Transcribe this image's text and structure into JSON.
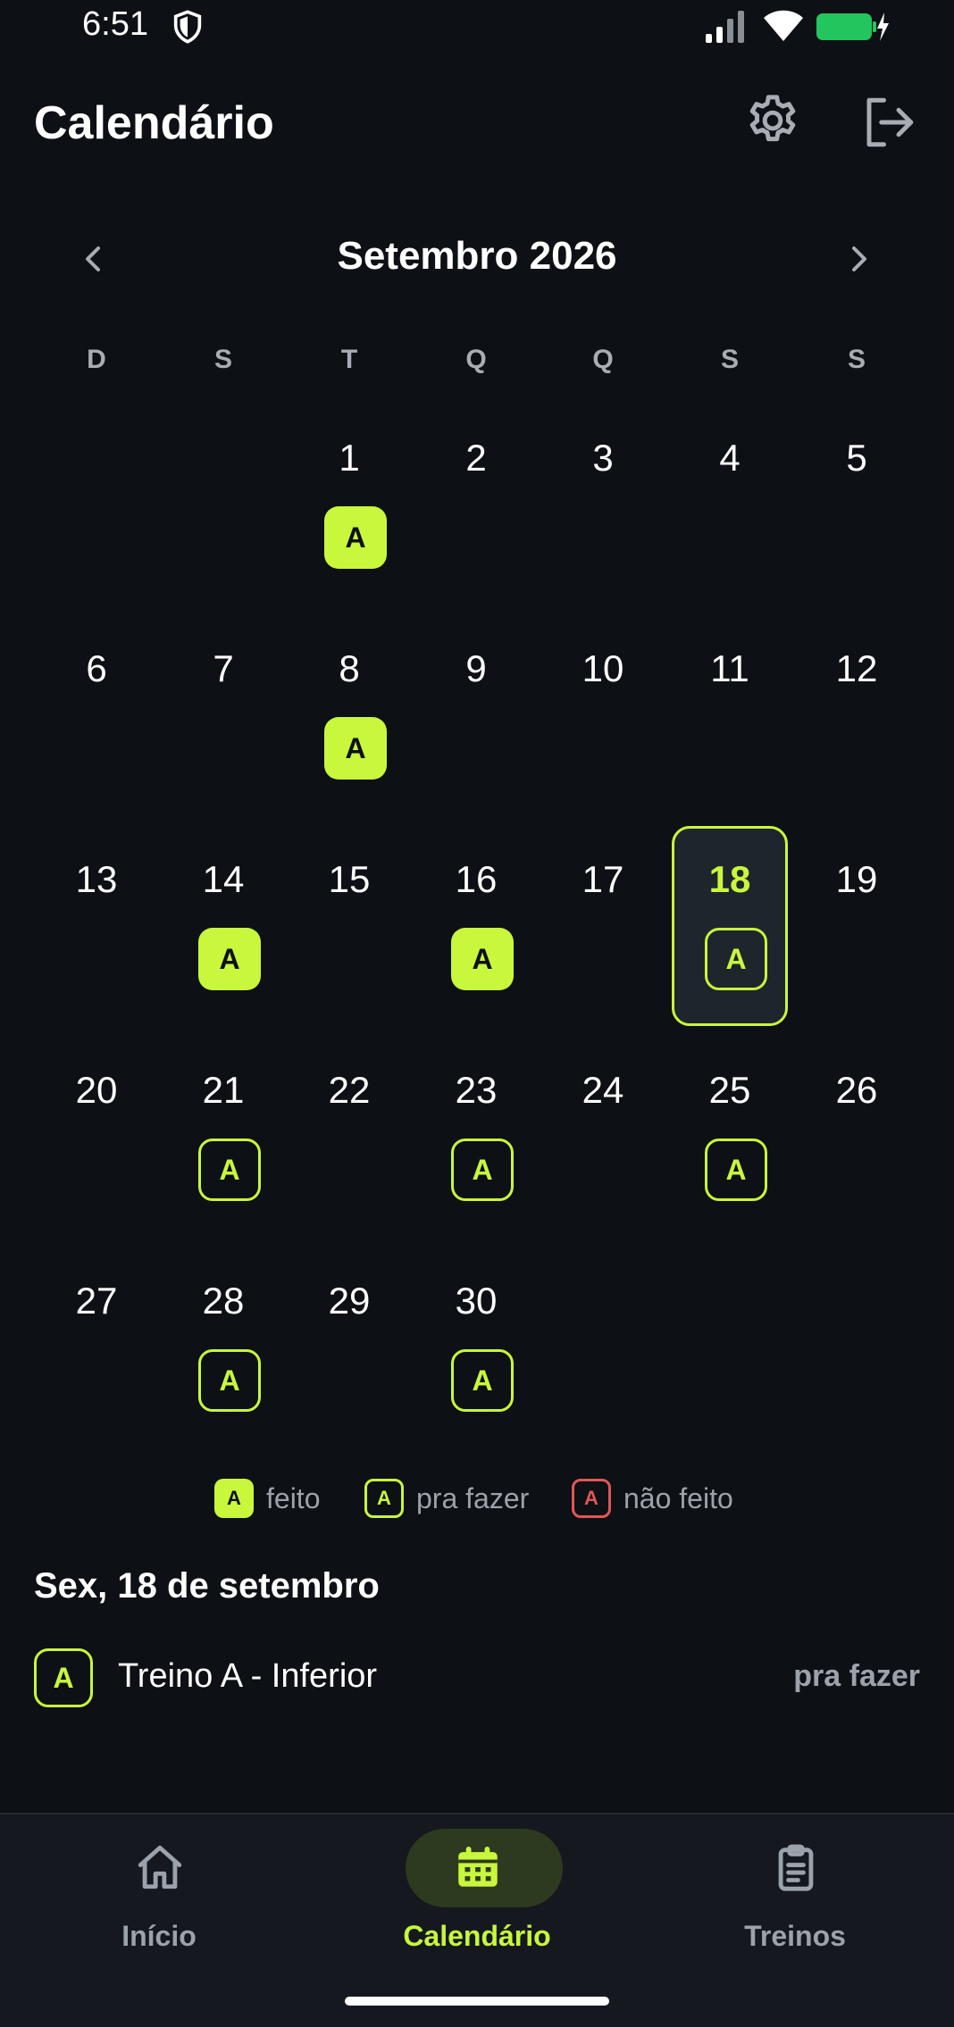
{
  "status_bar": {
    "time": "6:51"
  },
  "header": {
    "title": "Calendário"
  },
  "month": {
    "label": "Setembro 2026"
  },
  "weekdays": [
    "D",
    "S",
    "T",
    "Q",
    "Q",
    "S",
    "S"
  ],
  "days": [
    {
      "n": "1",
      "s": "done"
    },
    {
      "n": "2",
      "s": ""
    },
    {
      "n": "3",
      "s": ""
    },
    {
      "n": "4",
      "s": ""
    },
    {
      "n": "5",
      "s": ""
    },
    {
      "n": "6",
      "s": ""
    },
    {
      "n": "7",
      "s": ""
    },
    {
      "n": "8",
      "s": "done"
    },
    {
      "n": "9",
      "s": ""
    },
    {
      "n": "10",
      "s": ""
    },
    {
      "n": "11",
      "s": ""
    },
    {
      "n": "12",
      "s": ""
    },
    {
      "n": "13",
      "s": ""
    },
    {
      "n": "14",
      "s": "done"
    },
    {
      "n": "15",
      "s": ""
    },
    {
      "n": "16",
      "s": "done"
    },
    {
      "n": "17",
      "s": ""
    },
    {
      "n": "18",
      "s": "todo"
    },
    {
      "n": "19",
      "s": ""
    },
    {
      "n": "20",
      "s": ""
    },
    {
      "n": "21",
      "s": "todo"
    },
    {
      "n": "22",
      "s": ""
    },
    {
      "n": "23",
      "s": "todo"
    },
    {
      "n": "24",
      "s": ""
    },
    {
      "n": "25",
      "s": "todo"
    },
    {
      "n": "26",
      "s": ""
    },
    {
      "n": "27",
      "s": ""
    },
    {
      "n": "28",
      "s": "todo"
    },
    {
      "n": "29",
      "s": ""
    },
    {
      "n": "30",
      "s": "todo"
    }
  ],
  "selected_day": "18",
  "badge_letter": "A",
  "legend": [
    {
      "kind": "done",
      "letter": "A",
      "label": "feito"
    },
    {
      "kind": "todo",
      "letter": "A",
      "label": "pra fazer"
    },
    {
      "kind": "missed",
      "letter": "A",
      "label": "não feito"
    }
  ],
  "selected_panel": {
    "date": "Sex, 18 de setembro",
    "workout": {
      "letter": "A",
      "name": "Treino A - Inferior",
      "status": "pra fazer"
    }
  },
  "nav": [
    {
      "label": "Início",
      "icon": "home-icon",
      "active": false
    },
    {
      "label": "Calendário",
      "icon": "calendar-icon",
      "active": true
    },
    {
      "label": "Treinos",
      "icon": "clipboard-icon",
      "active": false
    }
  ],
  "colors": {
    "accent": "#c8f73c",
    "missed": "#e05757",
    "background": "#0d1014"
  }
}
